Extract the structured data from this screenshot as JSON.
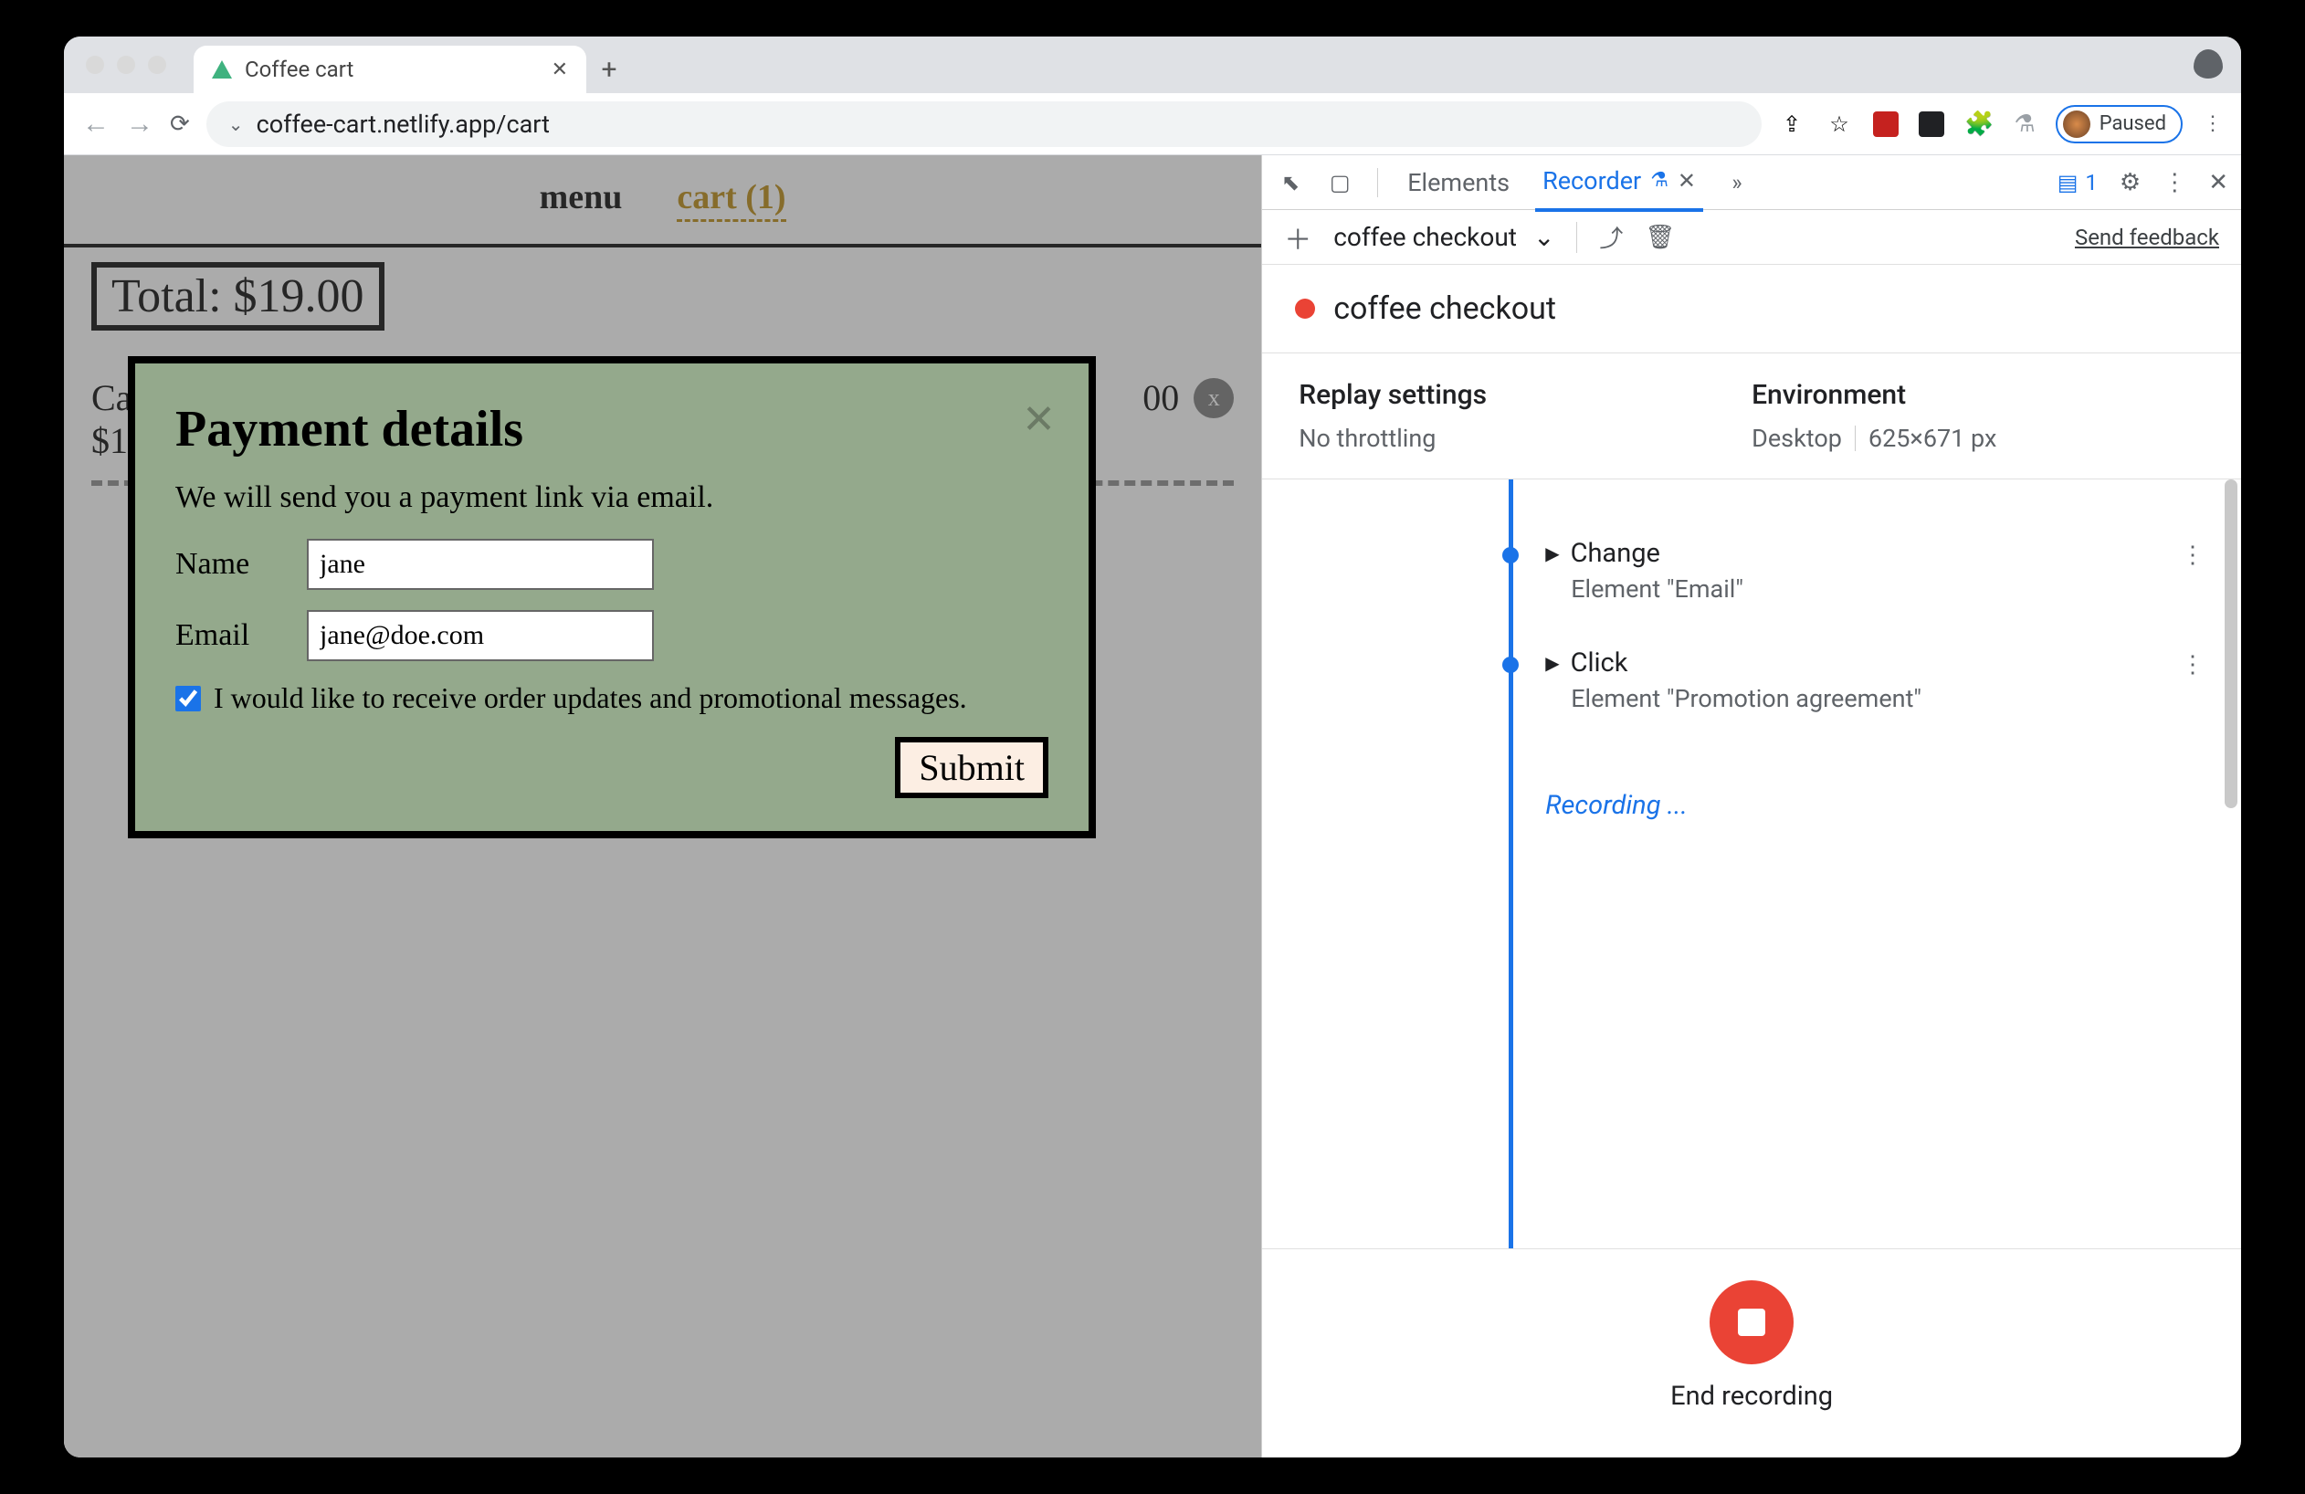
{
  "browser": {
    "tab_title": "Coffee cart",
    "url": "coffee-cart.netlify.app/cart",
    "profile_status": "Paused"
  },
  "page": {
    "nav": {
      "menu": "menu",
      "cart": "cart (1)"
    },
    "total_label": "Total: $19.00",
    "cart_item_name_truncated": "Ca",
    "cart_item_price_truncated": "$1",
    "cart_item_total_truncated": "00",
    "remove_btn": "x"
  },
  "modal": {
    "title": "Payment details",
    "subtitle": "We will send you a payment link via email.",
    "name_label": "Name",
    "name_value": "jane",
    "email_label": "Email",
    "email_value": "jane@doe.com",
    "promo_label": "I would like to receive order updates and promotional messages.",
    "submit_label": "Submit"
  },
  "devtools": {
    "tabs": {
      "elements": "Elements",
      "recorder": "Recorder"
    },
    "issues_count": "1",
    "send_feedback": "Send feedback",
    "recorder": {
      "recording_name": "coffee checkout",
      "title": "coffee checkout",
      "replay_settings_label": "Replay settings",
      "throttling": "No throttling",
      "environment_label": "Environment",
      "device": "Desktop",
      "viewport": "625×671 px",
      "steps": [
        {
          "action": "Change",
          "detail": "Element \"Email\""
        },
        {
          "action": "Click",
          "detail": "Element \"Promotion agreement\""
        }
      ],
      "status": "Recording ...",
      "end_label": "End recording"
    }
  }
}
